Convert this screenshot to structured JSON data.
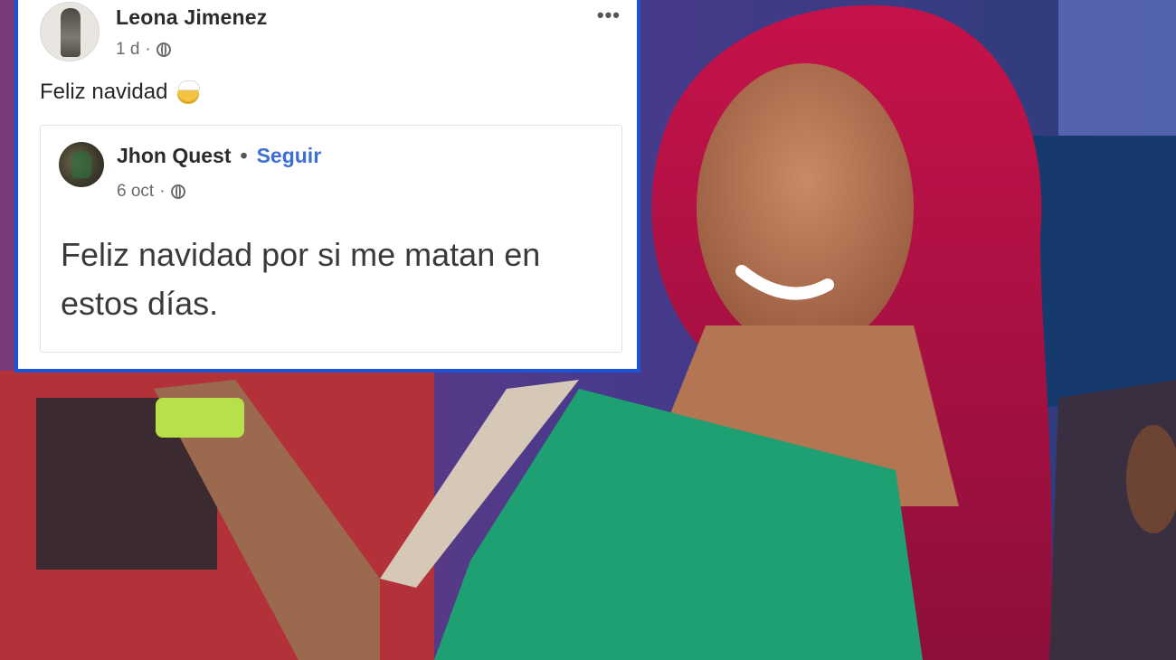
{
  "post": {
    "author": "Leona Jimenez",
    "time": "1 d",
    "meta_sep": "·",
    "text": "Feliz navidad",
    "icons": [
      "globe-icon",
      "more-options-icon",
      "santa-emoji-icon"
    ]
  },
  "shared_post": {
    "author": "Jhon Quest",
    "dot": "•",
    "follow_label": "Seguir",
    "time": "6 oct",
    "meta_sep": "·",
    "text": "Feliz navidad por si me matan en estos días."
  },
  "colors": {
    "card_border": "#1b54d6",
    "follow_link": "#3c6fd1",
    "text_dark": "#2b2b2b",
    "text_meta": "#6a6a6a"
  }
}
